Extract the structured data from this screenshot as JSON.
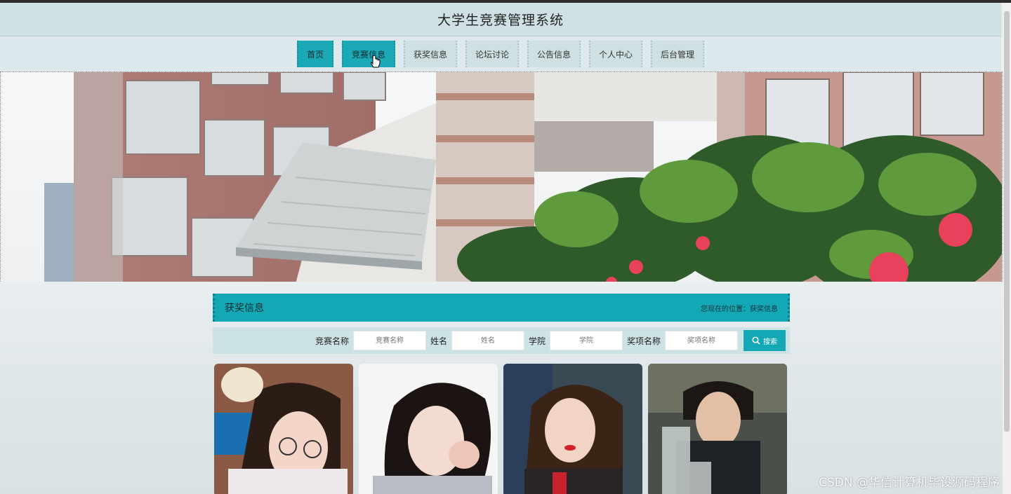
{
  "header": {
    "title": "大学生竞赛管理系统"
  },
  "nav": {
    "items": [
      {
        "label": "首页",
        "state": "active"
      },
      {
        "label": "竞赛信息",
        "state": "hover"
      },
      {
        "label": "获奖信息",
        "state": ""
      },
      {
        "label": "论坛讨论",
        "state": ""
      },
      {
        "label": "公告信息",
        "state": ""
      },
      {
        "label": "个人中心",
        "state": ""
      },
      {
        "label": "后台管理",
        "state": ""
      }
    ]
  },
  "section": {
    "title": "获奖信息",
    "breadcrumb": "您现在的位置：获奖信息"
  },
  "search": {
    "fields": [
      {
        "label": "竞赛名称",
        "placeholder": "竞赛名称"
      },
      {
        "label": "姓名",
        "placeholder": "姓名"
      },
      {
        "label": "学院",
        "placeholder": "学院"
      },
      {
        "label": "奖项名称",
        "placeholder": "奖项名称"
      }
    ],
    "button_label": "搜索"
  },
  "cards": [
    {
      "image": "student-photo-1"
    },
    {
      "image": "student-photo-2"
    },
    {
      "image": "student-photo-3"
    },
    {
      "image": "student-photo-4"
    }
  ],
  "watermark": "CSDN @华信计算机毕设源码程序",
  "colors": {
    "accent": "#14a8b6",
    "header_bg": "#cfe1e4",
    "nav_bg": "#dde8ec"
  }
}
